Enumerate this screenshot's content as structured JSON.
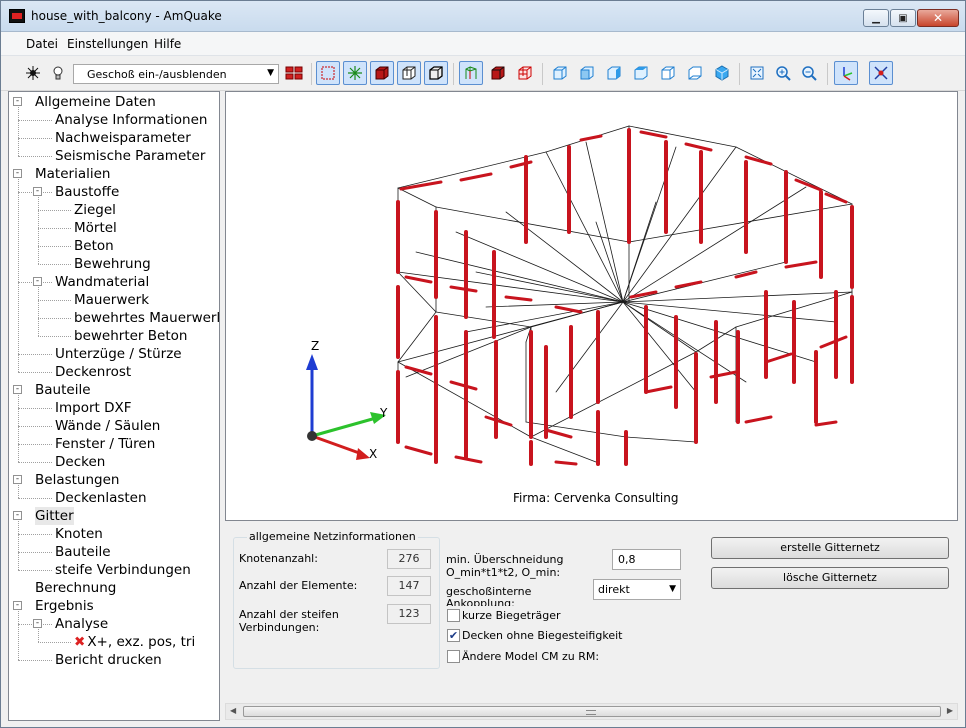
{
  "window": {
    "title": "house_with_balcony - AmQuake"
  },
  "menu": [
    "Datei",
    "Einstellungen",
    "Hilfe"
  ],
  "toolbar": {
    "dropdown_value": "Geschoß ein-/ausblenden",
    "icons": [
      "bug-icon",
      "bulb-icon",
      "floors-icon",
      "frame-icon",
      "node-icon",
      "solid-box-icon",
      "wire-box-icon",
      "box-edges-icon",
      "grid-green-icon",
      "red-box-icon",
      "red-wire-icon",
      "view-front-icon",
      "view-back-icon",
      "view-left-icon",
      "view-right-icon",
      "view-top-icon",
      "view-bottom-icon",
      "view-iso-icon",
      "zoom-fit-icon",
      "zoom-in-icon",
      "zoom-out-icon",
      "axes-icon",
      "cross-icon"
    ]
  },
  "tree": [
    {
      "label": "Allgemeine Daten",
      "level": 0,
      "expander": "-"
    },
    {
      "label": "Analyse Informationen",
      "level": 1
    },
    {
      "label": "Nachweisparameter",
      "level": 1
    },
    {
      "label": "Seismische Parameter",
      "level": 1
    },
    {
      "label": "Materialien",
      "level": 0,
      "expander": "-"
    },
    {
      "label": "Baustoffe",
      "level": 1,
      "expander": "-"
    },
    {
      "label": "Ziegel",
      "level": 2
    },
    {
      "label": "Mörtel",
      "level": 2
    },
    {
      "label": "Beton",
      "level": 2
    },
    {
      "label": "Bewehrung",
      "level": 2
    },
    {
      "label": "Wandmaterial",
      "level": 1,
      "expander": "-"
    },
    {
      "label": "Mauerwerk",
      "level": 2
    },
    {
      "label": "bewehrtes Mauerwerk",
      "level": 2
    },
    {
      "label": "bewehrter Beton",
      "level": 2
    },
    {
      "label": "Unterzüge / Stürze",
      "level": 1
    },
    {
      "label": "Deckenrost",
      "level": 1
    },
    {
      "label": "Bauteile",
      "level": 0,
      "expander": "-"
    },
    {
      "label": "Import DXF",
      "level": 1
    },
    {
      "label": "Wände / Säulen",
      "level": 1
    },
    {
      "label": "Fenster / Türen",
      "level": 1
    },
    {
      "label": "Decken",
      "level": 1
    },
    {
      "label": "Belastungen",
      "level": 0,
      "expander": "-"
    },
    {
      "label": "Deckenlasten",
      "level": 1
    },
    {
      "label": "Gitter",
      "level": 0,
      "expander": "-",
      "selected": true
    },
    {
      "label": "Knoten",
      "level": 1
    },
    {
      "label": "Bauteile",
      "level": 1
    },
    {
      "label": "steife Verbindungen",
      "level": 1
    },
    {
      "label": "Berechnung",
      "level": 0
    },
    {
      "label": "Ergebnis",
      "level": 0,
      "expander": "-"
    },
    {
      "label": "Analyse",
      "level": 1,
      "expander": "-"
    },
    {
      "label": "X+, exz. pos, tri",
      "level": 2,
      "icon": "red-x-icon"
    },
    {
      "label": "Bericht drucken",
      "level": 1
    }
  ],
  "viewport": {
    "axis_labels": {
      "z": "Z",
      "y": "Y",
      "x": "X"
    },
    "firma": "Firma: Cervenka Consulting",
    "colors": {
      "member": "#c8141e",
      "line": "#1a1a1a",
      "axis_z": "#1e3cd2",
      "axis_y": "#2cc22c",
      "axis_x": "#d21e1e"
    }
  },
  "panel": {
    "group_title": "allgemeine Netzinformationen",
    "knoten_label": "Knotenanzahl:",
    "knoten_value": "276",
    "elemente_label": "Anzahl der Elemente:",
    "elemente_value": "147",
    "steife_label_1": "Anzahl der steifen",
    "steife_label_2": "Verbindungen:",
    "steife_value": "123",
    "ueberschneidung_label_1": "min. Überschneidung",
    "ueberschneidung_label_2": "O_min*t1*t2, O_min:",
    "ueberschneidung_value": "0,8",
    "ankopplung_label_1": "geschoßinterne",
    "ankopplung_label_2": "Ankopplung:",
    "ankopplung_value": "direkt",
    "cb_kurze": {
      "label": "kurze Biegeträger",
      "checked": false
    },
    "cb_decken": {
      "label": "Decken ohne Biegesteifigkeit",
      "checked": true
    },
    "cb_model": {
      "label": "Ändere Model CM zu RM:",
      "checked": false
    },
    "btn_erstelle": "erstelle Gitternetz",
    "btn_loesche": "lösche Gitternetz"
  }
}
